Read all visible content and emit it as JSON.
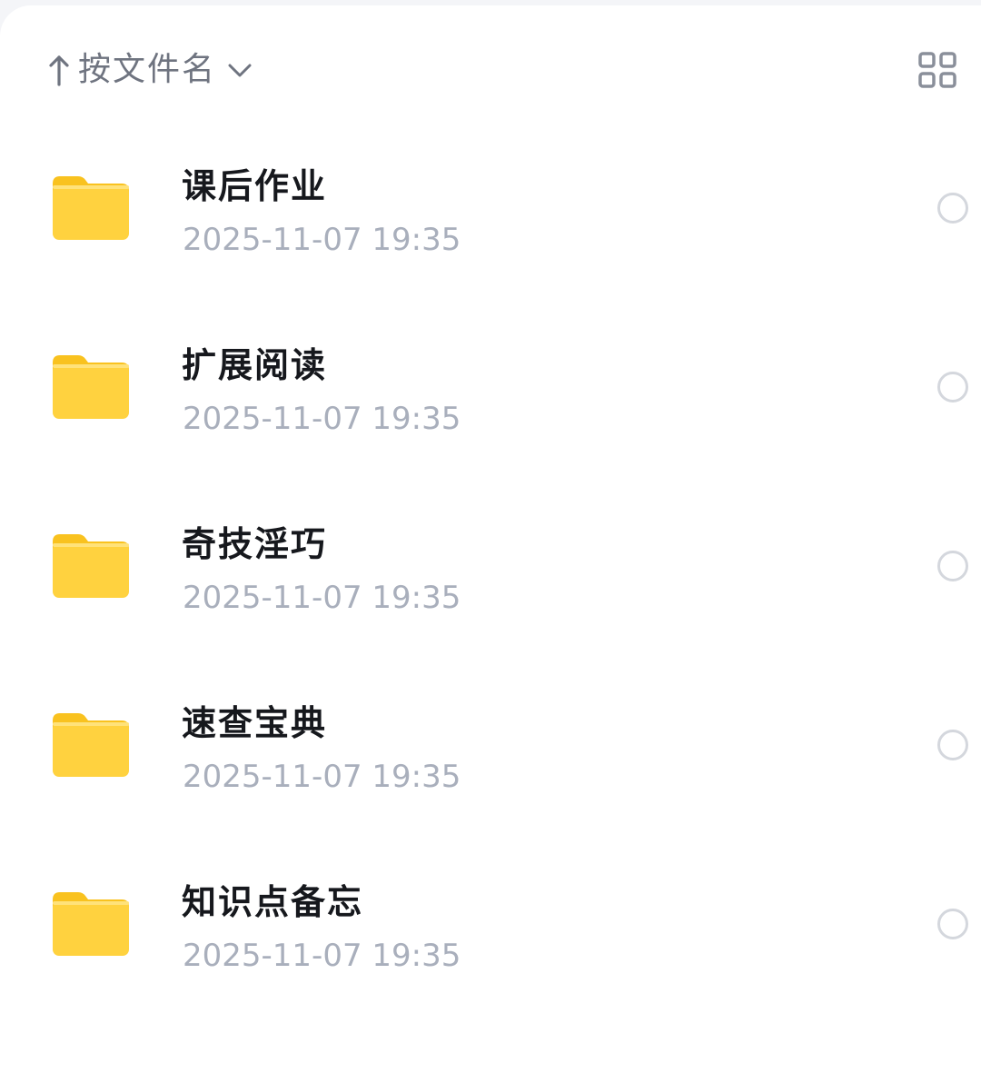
{
  "header": {
    "sort_label": "按文件名",
    "sort_direction_icon": "arrow-up-icon",
    "sort_dropdown_icon": "chevron-down-icon",
    "view_toggle_icon": "grid-view-icon"
  },
  "colors": {
    "folder": "#ffd23f",
    "folder_tab": "#f9c21f",
    "text_primary": "#16181d",
    "text_secondary": "#a9afbc",
    "radio_border": "#d4d7dd"
  },
  "folders": [
    {
      "name": "课后作业",
      "date": "2025-11-07 19:35"
    },
    {
      "name": "扩展阅读",
      "date": "2025-11-07 19:35"
    },
    {
      "name": "奇技淫巧",
      "date": "2025-11-07 19:35"
    },
    {
      "name": "速查宝典",
      "date": "2025-11-07 19:35"
    },
    {
      "name": "知识点备忘",
      "date": "2025-11-07 19:35"
    }
  ]
}
